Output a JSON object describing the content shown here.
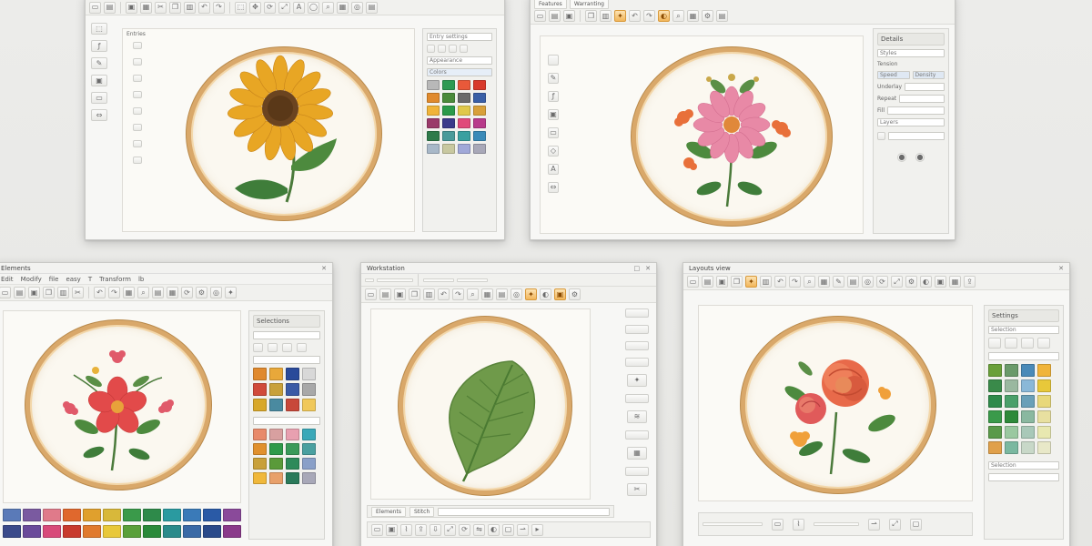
{
  "windows": [
    {
      "id": "w1",
      "title": "",
      "canvas_label": "Entries",
      "motif": "sunflower",
      "panel": {
        "rows": [
          "Entry settings",
          "Appearance",
          "Colors"
        ],
        "swatches": [
          "#b8b8b8",
          "#2e9a52",
          "#e8593a",
          "#d8392b",
          "#e08a2d",
          "#4a8a3a",
          "#6a6a6a",
          "#3a5fa6",
          "#f0b43a",
          "#2a9a4a",
          "#e0c84a",
          "#d8a03a",
          "#9a3a6a",
          "#3a3a8a",
          "#e04a7a",
          "#b83a8a",
          "#2e7a4a",
          "#4a9a9a",
          "#3aa0a0",
          "#3a8ab8",
          "#a8b8c8",
          "#c8c8a0",
          "#a0a8d8",
          "#a8a8b8"
        ]
      }
    },
    {
      "id": "w2",
      "title": "",
      "toolbar_text": [
        "Features",
        "Warranting"
      ],
      "motif": "pink-flower",
      "panel": {
        "title": "Details",
        "rows": [
          "Styles",
          "Tension",
          "Speed",
          "Density",
          "Underlay",
          "Repeat",
          "Fill",
          "Layers"
        ]
      }
    },
    {
      "id": "w3",
      "title": "Elements",
      "menu": [
        "Edit",
        "Modify",
        "file",
        "easy",
        "T",
        "Transform",
        "lb"
      ],
      "motif": "red-flower",
      "panel": {
        "title": "Selections",
        "swatches_a": [
          "#e0892d",
          "#e8a83a",
          "#2a4a9a",
          "#d8d8d8",
          "#d04a3a",
          "#c8a03a",
          "#3a5aa6",
          "#a8a8a8",
          "#d8a82a",
          "#4a8aa0",
          "#c8483a",
          "#f0c85a"
        ],
        "swatches_b": [
          "#e88a6a",
          "#d8a0a0",
          "#e8a0b0",
          "#3aa8b8",
          "#e0902d",
          "#2e9a4a",
          "#3a9a5a",
          "#4aa0a0",
          "#c8a03a",
          "#5a9a3a",
          "#2e8a5a",
          "#8aa0c8",
          "#f0b83a",
          "#e8a06a",
          "#2a7a5a",
          "#a8a8b8"
        ],
        "strip": [
          "#5a7ab8",
          "#7a5aa0",
          "#e07a8a",
          "#e0682d",
          "#e0a02d",
          "#d8b83a",
          "#3a9a4a",
          "#2e8a4a",
          "#2a9aa0",
          "#3a7ab8",
          "#2a5aa6",
          "#8a4a9a",
          "#3a4a8a",
          "#6a4a9a",
          "#d84a7a",
          "#c83a2d",
          "#e07a2d",
          "#e8c83a",
          "#5aa03a",
          "#2a8a3a",
          "#2a8a8a",
          "#3a6aa6",
          "#2a4a8a",
          "#8a3a8a"
        ]
      }
    },
    {
      "id": "w4",
      "title": "Workstation",
      "motif": "leaf",
      "bottom_labels": [
        "Elements",
        "Stitch"
      ]
    },
    {
      "id": "w5",
      "title": "Layouts view",
      "motif": "rose",
      "panel": {
        "title": "Settings",
        "sub": "Selection",
        "swatches": [
          "#6aa03a",
          "#6a9a6a",
          "#4a8ab8",
          "#f0b43a",
          "#3a8a4a",
          "#9ab8a0",
          "#8ab8d8",
          "#e8c83a",
          "#2e8a4a",
          "#4aa06a",
          "#6aa0b8",
          "#e8d87a",
          "#3a9a4a",
          "#2e8a3a",
          "#8ab8a0",
          "#e8e0a0",
          "#5a9a4a",
          "#9ac8a0",
          "#a8c8b8",
          "#e8e8b0",
          "#e0a04a",
          "#7ab8a0",
          "#c8d8c8",
          "#e8e8c8"
        ],
        "footer": "Selection"
      }
    }
  ]
}
